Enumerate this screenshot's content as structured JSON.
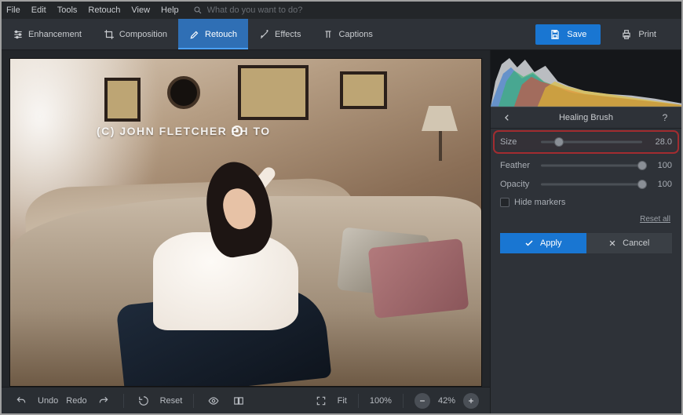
{
  "menu": {
    "items": [
      "File",
      "Edit",
      "Tools",
      "Retouch",
      "View",
      "Help"
    ],
    "search_placeholder": "What do you want to do?"
  },
  "toolbar": {
    "tabs": [
      {
        "label": "Enhancement"
      },
      {
        "label": "Composition"
      },
      {
        "label": "Retouch",
        "active": true
      },
      {
        "label": "Effects"
      },
      {
        "label": "Captions"
      }
    ],
    "save": "Save",
    "print": "Print"
  },
  "canvas": {
    "watermark": "(C) JOHN FLETCHER PH   TO"
  },
  "bottombar": {
    "undo": "Undo",
    "redo": "Redo",
    "reset": "Reset",
    "fit": "Fit",
    "zoom_fixed": "100%",
    "zoom_current": "42%"
  },
  "panel": {
    "title": "Healing Brush",
    "sliders": [
      {
        "key": "size",
        "label": "Size",
        "value": "28.0",
        "percent": 18,
        "highlight": true
      },
      {
        "key": "feather",
        "label": "Feather",
        "value": "100",
        "percent": 100
      },
      {
        "key": "opacity",
        "label": "Opacity",
        "value": "100",
        "percent": 100
      }
    ],
    "hide_markers": "Hide markers",
    "reset_all": "Reset all",
    "apply": "Apply",
    "cancel": "Cancel"
  }
}
